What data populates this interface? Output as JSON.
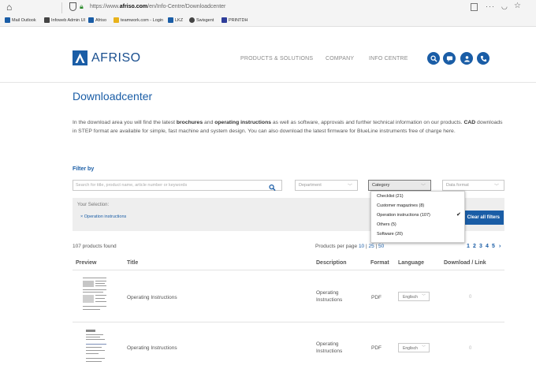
{
  "browser": {
    "url_prefix": "https://www.",
    "url_domain": "afriso.com",
    "url_path": "/en/Info-Centre/Downloadcenter",
    "bookmarks": [
      {
        "label": "Mail Outlook",
        "color": "#1a5da6"
      },
      {
        "label": "Infoweb Admin UI",
        "color": "#444444"
      },
      {
        "label": "Afriso",
        "color": "#1a5da6"
      },
      {
        "label": "teamwork.com - Login",
        "color": "#e8b21b"
      },
      {
        "label": "LKZ",
        "color": "#1a5da6"
      },
      {
        "label": "Swisgent",
        "color": "#444444"
      },
      {
        "label": "PRINTDH",
        "color": "#2e3d9a"
      }
    ]
  },
  "header": {
    "logo_text": "AFRISO",
    "nav": [
      "PRODUCTS & SOLUTIONS",
      "COMPANY",
      "INFO CENTRE"
    ],
    "icons": [
      "search-icon",
      "chat-icon",
      "user-icon",
      "phone-icon"
    ],
    "accent": "#1a5da6"
  },
  "page": {
    "title": "Downloadcenter",
    "intro": {
      "a": "In the download area you will find the latest ",
      "b": "brochures",
      "c": " and ",
      "d": "operating instructions",
      "e": " as well as software, approvals and further technical information on our products. ",
      "f": "CAD",
      "g": " downloads in STEP format are available for simple, fast machine and system design. You can also download the latest firmware for BlueLine instruments free of charge here."
    }
  },
  "filter": {
    "label": "Filter by",
    "search_placeholder": "Search for title, product name, article number or keywords",
    "department": "Department",
    "category": "Category",
    "data_format": "Data format",
    "category_options": [
      "Checklist (21)",
      "Customer magazines (8)",
      "Operation instructions (107)",
      "Others (5)",
      "Software (20)"
    ],
    "selected_option": "Operation instructions (107)"
  },
  "selection": {
    "label": "Your Selection:",
    "item": "Operation instructions",
    "clear": "Clear all filters"
  },
  "results": {
    "found": "107 products found",
    "per_page_label": "Products per page",
    "per_page": [
      "10",
      "25",
      "50"
    ],
    "pages": [
      "1",
      "2",
      "3",
      "4",
      "5",
      "›"
    ]
  },
  "table": {
    "headers": [
      "Preview",
      "Title",
      "Description",
      "Format",
      "Language",
      "Download / Link"
    ],
    "rows": [
      {
        "title": "Operating Instructions",
        "desc1": "Operating",
        "desc2": "Instructions",
        "format": "PDF",
        "language": "Englisch",
        "download": "0"
      },
      {
        "title": "Operating Instructions",
        "desc1": "Operating",
        "desc2": "Instructions",
        "format": "PDF",
        "language": "Englisch",
        "download": "0"
      }
    ]
  }
}
